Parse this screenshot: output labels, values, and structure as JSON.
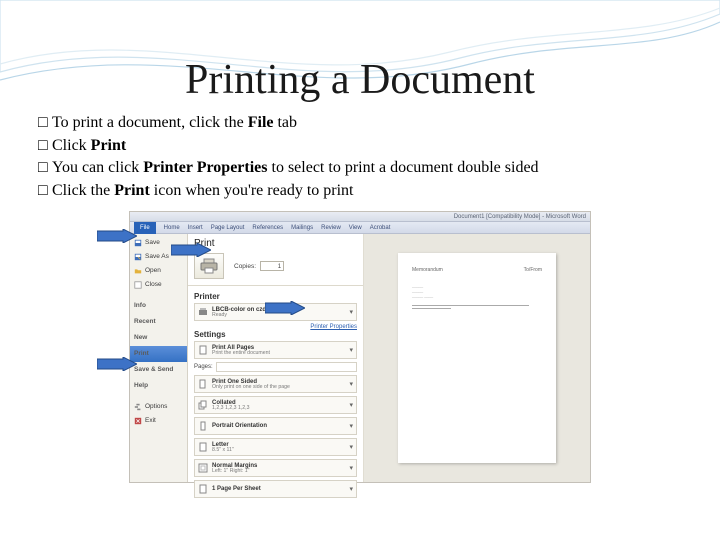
{
  "slide": {
    "title": "Printing a Document",
    "bullets": [
      {
        "pre": "To print a document, click the ",
        "bold": "File",
        "post": " tab"
      },
      {
        "pre": "Click ",
        "bold": "Print",
        "post": ""
      },
      {
        "pre": "You can click ",
        "bold": "Printer Properties",
        "post": " to select to print a document double sided"
      },
      {
        "pre": "Click the ",
        "bold": "Print",
        "post": " icon when you're ready to print"
      }
    ]
  },
  "word": {
    "title_suffix": "[Compatibility Mode] - Microsoft Word",
    "title_prefix": "Document1",
    "tabs": [
      "File",
      "Home",
      "Insert",
      "Page Layout",
      "References",
      "Mailings",
      "Review",
      "View",
      "Acrobat"
    ],
    "nav": {
      "save": "Save",
      "save_as": "Save As",
      "open": "Open",
      "close": "Close",
      "info": "Info",
      "recent": "Recent",
      "new": "New",
      "print": "Print",
      "save_send": "Save & Send",
      "help": "Help",
      "options": "Options",
      "exit": "Exit"
    },
    "center": {
      "heading": "Print",
      "copies_label": "Copies:",
      "copies_value": "1",
      "printer_heading": "Printer",
      "printer_name": "LBCB-color on czdcserver1",
      "printer_status": "Ready",
      "printer_props": "Printer Properties",
      "settings_heading": "Settings",
      "pages_label": "Pages:",
      "opt_all": {
        "t": "Print All Pages",
        "s": "Print the entire document"
      },
      "opt_one_sided": {
        "t": "Print One Sided",
        "s": "Only print on one side of the page"
      },
      "opt_collated": {
        "t": "Collated",
        "s": "1,2,3   1,2,3   1,2,3"
      },
      "opt_portrait": {
        "t": "Portrait Orientation",
        "s": ""
      },
      "opt_letter": {
        "t": "Letter",
        "s": "8.5\" x 11\""
      },
      "opt_margins": {
        "t": "Normal Margins",
        "s": "Left: 1\"   Right: 1\""
      },
      "opt_per_sheet": {
        "t": "1 Page Per Sheet",
        "s": ""
      }
    },
    "preview": {
      "h_left": "Memorandum",
      "h_right": "To/From",
      "lines": "sample text content of the document preview page"
    }
  }
}
